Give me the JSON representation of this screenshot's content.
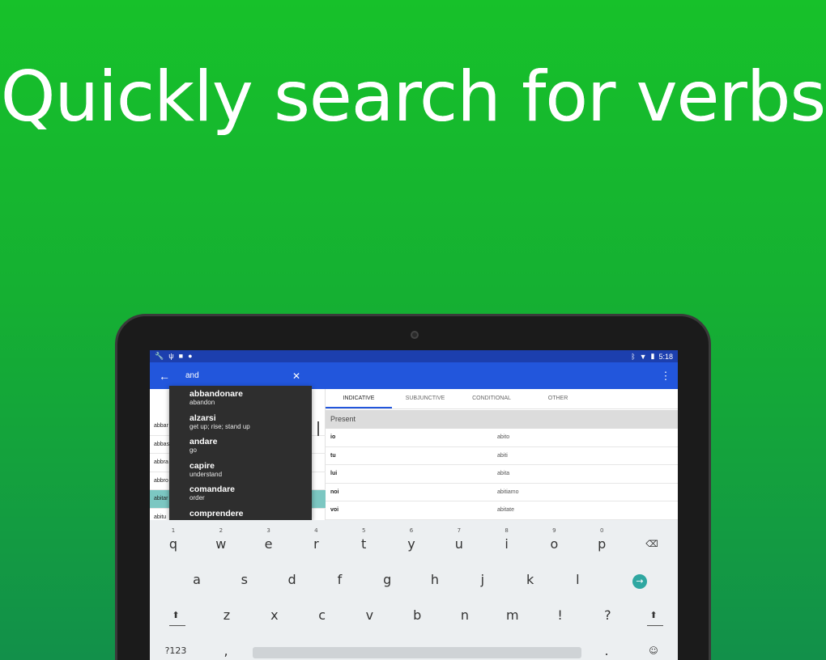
{
  "headline": "Quickly search for verbs",
  "status_bar": {
    "left_icons": [
      "wrench-icon",
      "usb-icon",
      "lock-icon",
      "lightbulb-icon"
    ],
    "time": "5:18"
  },
  "app_bar": {
    "search_value": "and",
    "back_icon": "arrow-left",
    "clear_icon": "close",
    "menu_icon": "more-vertical"
  },
  "suggestions": [
    {
      "verb": "abbandonare",
      "meaning": "abandon"
    },
    {
      "verb": "alzarsi",
      "meaning": "get up; rise; stand up"
    },
    {
      "verb": "andare",
      "meaning": "go"
    },
    {
      "verb": "capire",
      "meaning": "understand"
    },
    {
      "verb": "comandare",
      "meaning": "order"
    },
    {
      "verb": "comprendere",
      "meaning": ""
    }
  ],
  "verb_list": [
    "abbar",
    "abbas",
    "abbra",
    "abbro",
    "abitar",
    "abitu"
  ],
  "tabs": [
    "INDICATIVE",
    "SUBJUNCTIVE",
    "CONDITIONAL",
    "OTHER"
  ],
  "tense": "Present",
  "conjugation": [
    {
      "pronoun": "io",
      "form": "abito"
    },
    {
      "pronoun": "tu",
      "form": "abiti"
    },
    {
      "pronoun": "lui",
      "form": "abita"
    },
    {
      "pronoun": "noi",
      "form": "abitiamo"
    },
    {
      "pronoun": "voi",
      "form": "abitate"
    }
  ],
  "keyboard": {
    "row1": [
      "q",
      "w",
      "e",
      "r",
      "t",
      "y",
      "u",
      "i",
      "o",
      "p"
    ],
    "row1_hints": [
      "1",
      "2",
      "3",
      "4",
      "5",
      "6",
      "7",
      "8",
      "9",
      "0"
    ],
    "row2": [
      "a",
      "s",
      "d",
      "f",
      "g",
      "h",
      "j",
      "k",
      "l"
    ],
    "row3": [
      "z",
      "x",
      "c",
      "v",
      "b",
      "n",
      "m",
      "!",
      "?"
    ],
    "symbols_label": "?123",
    "comma": ",",
    "period": ".",
    "backspace": "⌫",
    "enter": "→",
    "shift": "⬆",
    "emoji": "☺"
  },
  "colors": {
    "background_top": "#17c12a",
    "app_bar": "#2256dc",
    "selected_row": "#7cc7c2",
    "enter_key": "#2fa7a1"
  }
}
